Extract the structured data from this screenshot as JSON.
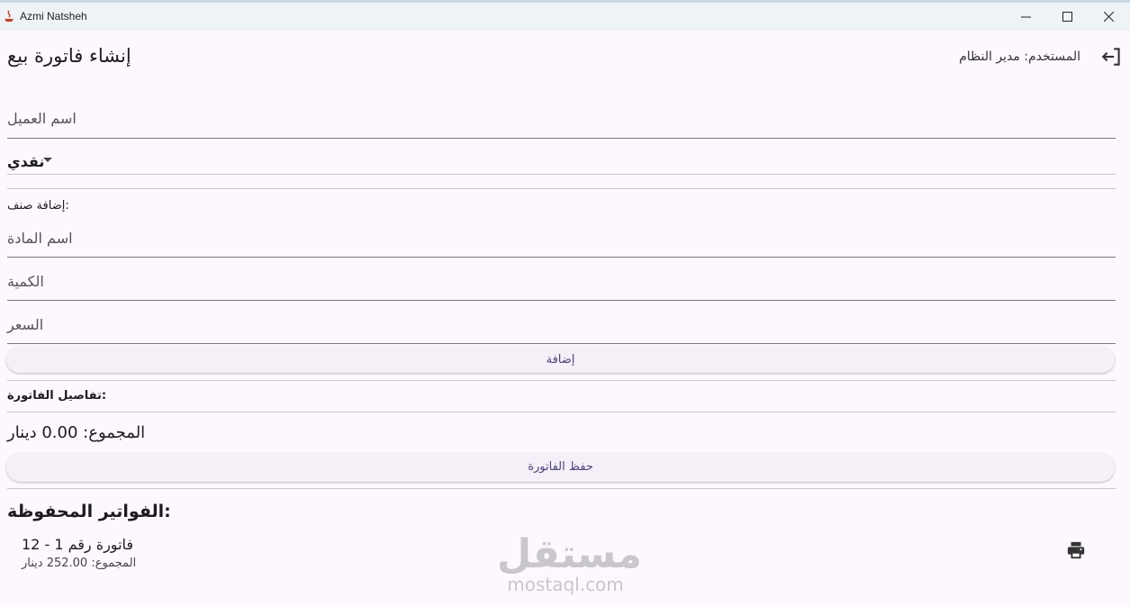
{
  "window": {
    "title": "Azmi Natsheh"
  },
  "header": {
    "page_title": "إنشاء فاتورة بيع",
    "user_label": "المستخدم: مدير النظام"
  },
  "form": {
    "customer_placeholder": "اسم العميل",
    "payment_type": "نقدي",
    "add_item_label": "إضافة صنف:",
    "item_name_placeholder": "اسم المادة",
    "quantity_placeholder": "الكمية",
    "price_placeholder": "السعر",
    "add_button": "إضافة"
  },
  "invoice": {
    "details_label": "تفاصيل الفاتورة:",
    "total": "المجموع: 0.00 دينار",
    "save_button": "حفظ الفاتورة"
  },
  "saved": {
    "title": "الفواتير المحفوظة:",
    "items": [
      {
        "title": "فاتورة رقم 1 - 12",
        "total": "المجموع: 252.00 دينار"
      }
    ]
  },
  "watermark": {
    "arabic": "مستقل",
    "latin": "mostaql.com"
  }
}
